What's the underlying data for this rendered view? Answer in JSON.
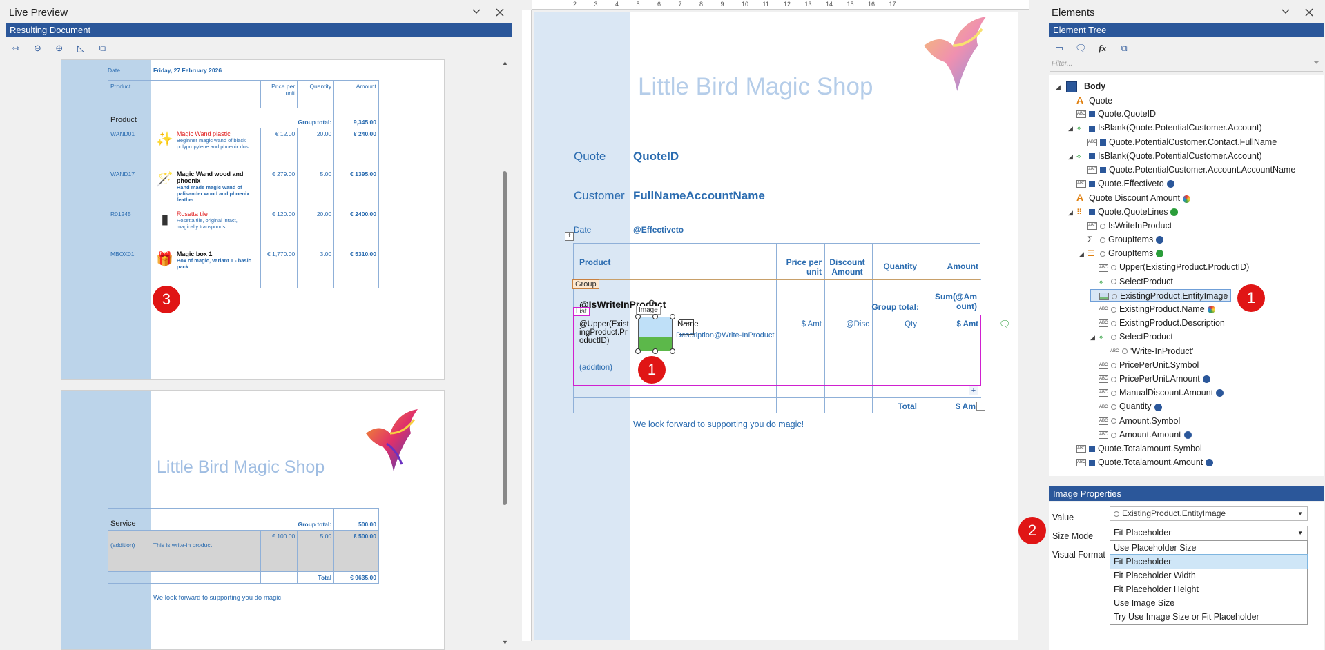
{
  "live_preview": {
    "title": "Live Preview",
    "subtitle": "Resulting Document",
    "page1": {
      "date_label": "Date",
      "date_value": "Friday, 27 February 2026",
      "headers": [
        "Product",
        "Price per unit",
        "Quantity",
        "Amount"
      ],
      "group_label": "Product",
      "group_total_label": "Group total:",
      "group_total_value": "9,345.00",
      "rows": [
        {
          "id": "WAND01",
          "name": "Magic Wand plastic",
          "desc": "Beginner magic wand of black polypropylene and phoenix dust",
          "price": "€ 12.00",
          "qty": "20.00",
          "amount": "€ 240.00",
          "red": true
        },
        {
          "id": "WAND17",
          "name": "Magic Wand wood and phoenix",
          "desc": "Hand made magic wand of palisander wood and phoenix feather",
          "price": "€ 279.00",
          "qty": "5.00",
          "amount": "€ 1395.00",
          "red": false
        },
        {
          "id": "R01245",
          "name": "Rosetta tile",
          "desc": "Rosetta tile, original intact, magically transponds",
          "price": "€ 120.00",
          "qty": "20.00",
          "amount": "€ 2400.00",
          "red": true
        },
        {
          "id": "MBOX01",
          "name": "Magic box 1",
          "desc": "Box of magic, variant 1 - basic pack",
          "price": "€ 1,770.00",
          "qty": "3.00",
          "amount": "€ 5310.00",
          "red": false
        }
      ]
    },
    "page2": {
      "shop_title": "Little Bird Magic Shop",
      "service_label": "Service",
      "group_total_label": "Group total:",
      "group_total_value": "500.00",
      "addition": "(addition)",
      "addition_desc": "This is write-in product",
      "price": "€ 100.00",
      "qty": "5.00",
      "amount": "€ 500.00",
      "total_label": "Total",
      "total_value": "€ 9635.00",
      "footer": "We look forward to supporting you do magic!"
    }
  },
  "designer": {
    "shop_title": "Little Bird Magic Shop",
    "quote_label": "Quote",
    "quote_field": "QuoteID",
    "customer_label": "Customer",
    "customer_field": "FullNameAccountName",
    "date_label": "Date",
    "date_field": "@Effectiveto",
    "headers": {
      "product": "Product",
      "price": "Price per unit",
      "discount": "Discount Amount",
      "quantity": "Quantity",
      "amount": "Amount"
    },
    "group_tag": "Group",
    "list_tag": "List",
    "image_tag": "Image",
    "is_write_in": "@IsWriteInProduct",
    "group_total_label": "Group total:",
    "group_total_field": "Sum(@Amount)",
    "product_id_field": "@Upper(ExistingProduct.ProductID)",
    "addition": "(addition)",
    "name_field": "Name",
    "desc_field": "Description@Write-InProduct",
    "amt_field": "$ Amt",
    "disc_field": "@Disc",
    "qty_field": "Qty",
    "total_label": "Total",
    "total_field": "$ Amt",
    "footer": "We look forward to supporting you do magic!"
  },
  "elements": {
    "title": "Elements",
    "tree_title": "Element Tree",
    "filter_placeholder": "Filter...",
    "root": "Body",
    "tree": [
      {
        "label": "Quote",
        "indent": 0,
        "icon": "A"
      },
      {
        "label": "Quote.QuoteID",
        "indent": 0,
        "icon": "abc"
      },
      {
        "label": "IsBlank(Quote.PotentialCustomer.Account)",
        "indent": 0,
        "icon": "cond",
        "arrow": true
      },
      {
        "label": "Quote.PotentialCustomer.Contact.FullName",
        "indent": 1,
        "icon": "abc"
      },
      {
        "label": "IsBlank(Quote.PotentialCustomer.Account)",
        "indent": 0,
        "icon": "cond",
        "arrow": true
      },
      {
        "label": "Quote.PotentialCustomer.Account.AccountName",
        "indent": 1,
        "icon": "abc"
      },
      {
        "label": "Quote.Effectiveto",
        "indent": 0,
        "icon": "abc",
        "badge": "blue"
      },
      {
        "label": "Quote Discount Amount",
        "indent": 0,
        "icon": "A",
        "badge": "rainbow"
      },
      {
        "label": "Quote.QuoteLines",
        "indent": 0,
        "icon": "grid",
        "arrow": true,
        "badge": "green"
      },
      {
        "label": "IsWriteInProduct",
        "indent": 1,
        "icon": "abc"
      },
      {
        "label": "GroupItems",
        "indent": 1,
        "icon": "sum",
        "badge": "blue"
      },
      {
        "label": "GroupItems",
        "indent": 1,
        "icon": "list",
        "arrow": true,
        "badge": "green"
      },
      {
        "label": "Upper(ExistingProduct.ProductID)",
        "indent": 2,
        "icon": "abc"
      },
      {
        "label": "SelectProduct",
        "indent": 2,
        "icon": "cond"
      },
      {
        "label": "ExistingProduct.EntityImage",
        "indent": 2,
        "icon": "img",
        "selected": true
      },
      {
        "label": "ExistingProduct.Name",
        "indent": 2,
        "icon": "abc",
        "badge": "rainbow"
      },
      {
        "label": "ExistingProduct.Description",
        "indent": 2,
        "icon": "abc"
      },
      {
        "label": "SelectProduct",
        "indent": 2,
        "icon": "cond",
        "arrow": true
      },
      {
        "label": "'Write-InProduct'",
        "indent": 3,
        "icon": "abc"
      },
      {
        "label": "PricePerUnit.Symbol",
        "indent": 2,
        "icon": "abc"
      },
      {
        "label": "PricePerUnit.Amount",
        "indent": 2,
        "icon": "abc",
        "badge": "blue"
      },
      {
        "label": "ManualDiscount.Amount",
        "indent": 2,
        "icon": "abc",
        "badge": "blue"
      },
      {
        "label": "Quantity",
        "indent": 2,
        "icon": "abc",
        "badge": "blue"
      },
      {
        "label": "Amount.Symbol",
        "indent": 2,
        "icon": "abc"
      },
      {
        "label": "Amount.Amount",
        "indent": 2,
        "icon": "abc",
        "badge": "blue"
      },
      {
        "label": "Quote.Totalamount.Symbol",
        "indent": 0,
        "icon": "abc"
      },
      {
        "label": "Quote.Totalamount.Amount",
        "indent": 0,
        "icon": "abc",
        "badge": "blue"
      }
    ],
    "props_title": "Image Properties",
    "value_label": "Value",
    "value": "ExistingProduct.EntityImage",
    "size_mode_label": "Size Mode",
    "size_mode_value": "Fit Placeholder",
    "visual_format_label": "Visual Format",
    "size_mode_options": [
      "Use Placeholder Size",
      "Fit Placeholder",
      "Fit Placeholder Width",
      "Fit Placeholder Height",
      "Use Image Size",
      "Try Use Image Size or Fit Placeholder"
    ],
    "selected_option": 1
  },
  "badges": {
    "one": "1",
    "two": "2",
    "three": "3"
  },
  "ruler": {
    "ticks": [
      "2",
      "3",
      "4",
      "5",
      "6",
      "7",
      "8",
      "9",
      "10",
      "11",
      "12",
      "13",
      "14",
      "15",
      "16",
      "17"
    ]
  }
}
